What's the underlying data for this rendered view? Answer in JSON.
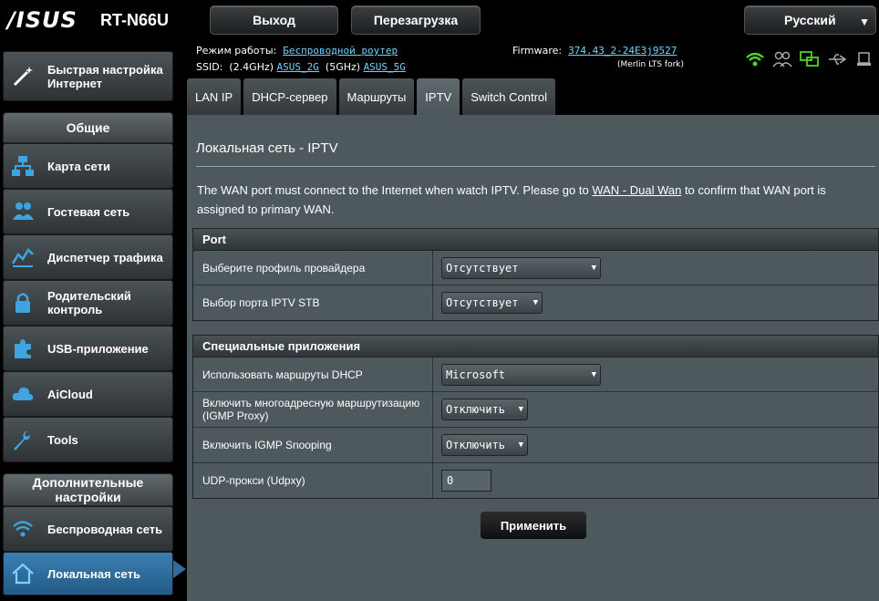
{
  "header": {
    "brand": "/ISUS",
    "model": "RT-N66U",
    "logout_label": "Выход",
    "reboot_label": "Перезагрузка",
    "language": "Русский"
  },
  "status": {
    "mode_label": "Режим работы:",
    "mode_value": "Беспроводной роутер",
    "ssid_label": "SSID:",
    "ssid_24_label": "(2.4GHz)",
    "ssid_24": "ASUS_2G",
    "ssid_5_label": "(5GHz)",
    "ssid_5": "ASUS_5G",
    "firmware_label": "Firmware:",
    "firmware_value": "374.43_2-24E3j9527",
    "firmware_note": "(Merlin LTS fork)"
  },
  "sidebar": {
    "quick_setup": "Быстрая настройка Интернет",
    "general_header": "Общие",
    "items": [
      {
        "label": "Карта сети",
        "icon": "network-map-icon"
      },
      {
        "label": "Гостевая сеть",
        "icon": "guest-network-icon"
      },
      {
        "label": "Диспетчер трафика",
        "icon": "traffic-manager-icon"
      },
      {
        "label": "Родительский контроль",
        "icon": "parental-control-icon"
      },
      {
        "label": "USB-приложение",
        "icon": "usb-app-icon"
      },
      {
        "label": "AiCloud",
        "icon": "aicloud-icon"
      },
      {
        "label": "Tools",
        "icon": "tools-icon"
      }
    ],
    "advanced_header": "Дополнительные настройки",
    "advanced_items": [
      {
        "label": "Беспроводная сеть",
        "icon": "wireless-icon"
      },
      {
        "label": "Локальная сеть",
        "icon": "lan-home-icon"
      }
    ]
  },
  "tabs": [
    "LAN IP",
    "DHCP-сервер",
    "Маршруты",
    "IPTV",
    "Switch Control"
  ],
  "active_tab": "IPTV",
  "page": {
    "title": "Локальная сеть - IPTV",
    "desc_before": "The WAN port must connect to the Internet when watch IPTV. Please go to ",
    "desc_link": "WAN - Dual Wan",
    "desc_after": " to confirm that WAN port is assigned to primary WAN."
  },
  "port_section": {
    "title": "Port",
    "rows": [
      {
        "label": "Выберите профиль провайдера",
        "value": "Отсутствует"
      },
      {
        "label": "Выбор порта IPTV STB",
        "value": "Отсутствует"
      }
    ]
  },
  "special_section": {
    "title": "Специальные приложения",
    "rows": [
      {
        "label": "Использовать маршруты DHCP",
        "value": "Microsoft"
      },
      {
        "label": "Включить многоадресную маршрутизацию (IGMP Proxy)",
        "value": "Отключить"
      },
      {
        "label": "Включить IGMP Snooping",
        "value": "Отключить"
      },
      {
        "label": "UDP-прокси (Udpxy)",
        "value": "0"
      }
    ]
  },
  "apply_label": "Применить"
}
